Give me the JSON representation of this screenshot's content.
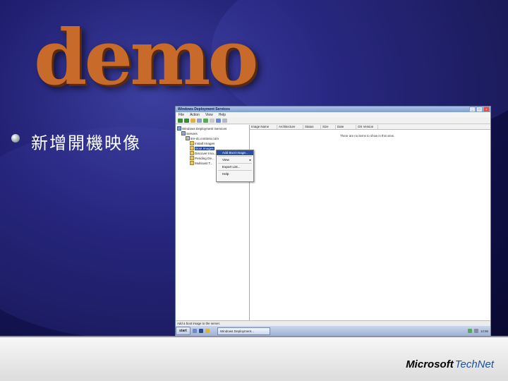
{
  "slide": {
    "headline": "demo",
    "bullet": "新增開機映像",
    "logo_microsoft": "Microsoft",
    "logo_technet": "TechNet"
  },
  "window": {
    "title": "Windows Deployment Services",
    "menu": [
      "File",
      "Action",
      "View",
      "Help"
    ],
    "tree": {
      "root": "Windows Deployment Services",
      "servers": "Servers",
      "server": "sre-dc.contoso.com",
      "children": [
        "Install Images",
        "Boot Images",
        "Discover Ima...",
        "Pending De...",
        "Multicast T..."
      ]
    },
    "columns": [
      "Image Name",
      "Architecture",
      "Status",
      "Size",
      "Date",
      "OS Version"
    ],
    "empty_message": "There are no items to show in this view.",
    "context_menu": [
      "Add Boot Image...",
      "View",
      "Export List...",
      "Help"
    ],
    "status_text": "Add a boot image to the server.",
    "taskbar": {
      "start": "start",
      "task": "Windows Deployment...",
      "clock": "12:56"
    }
  },
  "colors": {
    "background": "#1f1e70",
    "accent_orange": "#c76a2a",
    "selection": "#1d3f91"
  }
}
